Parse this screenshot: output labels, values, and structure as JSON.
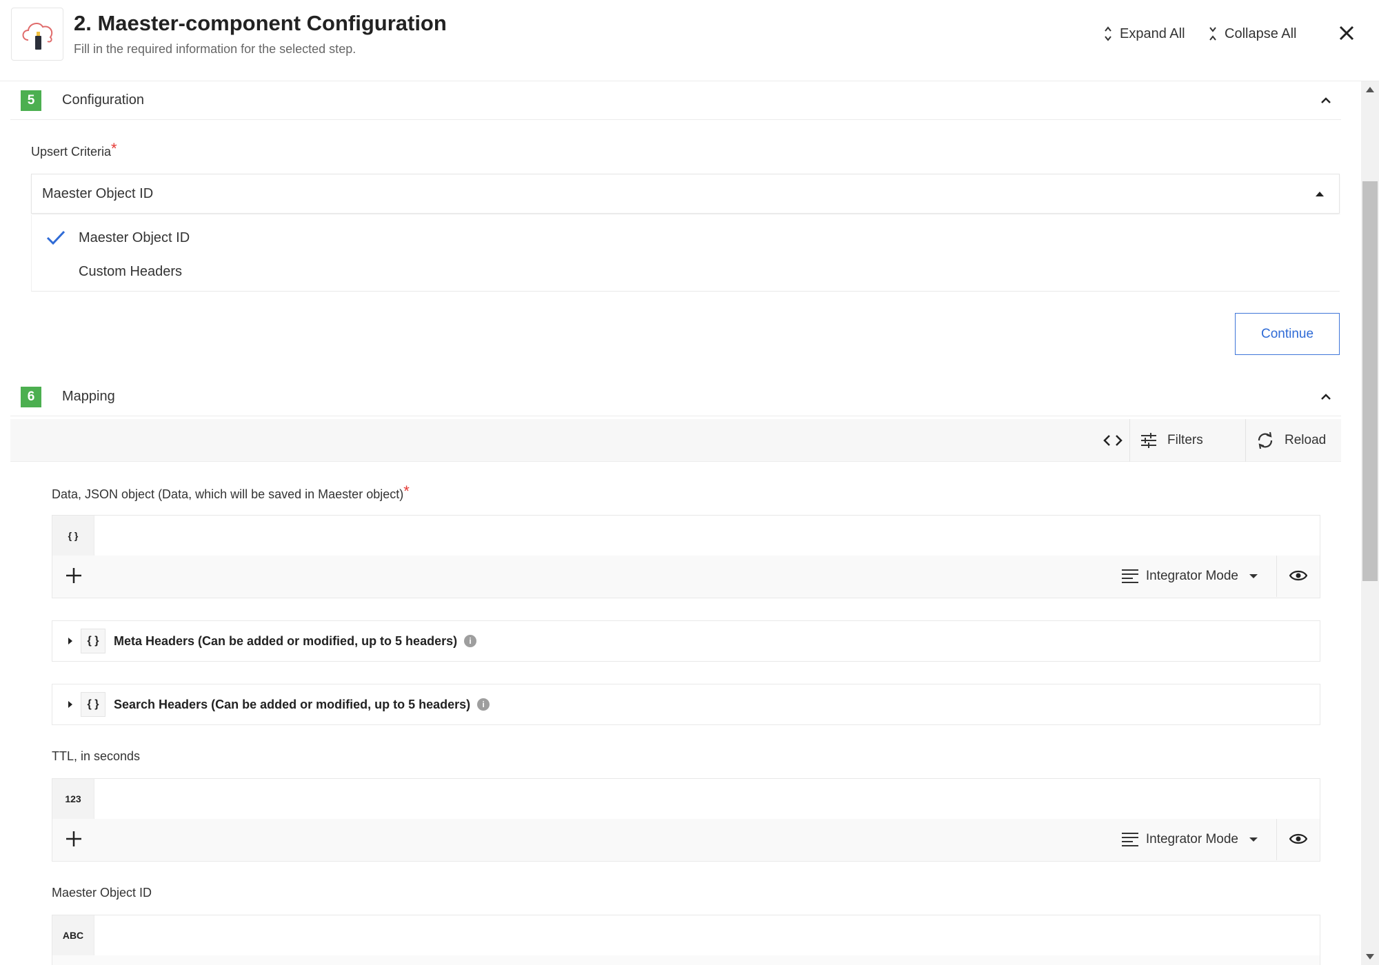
{
  "header": {
    "title": "2. Maester-component Configuration",
    "subtitle": "Fill in the required information for the selected step.",
    "expand_all": "Expand All",
    "collapse_all": "Collapse All"
  },
  "configuration": {
    "step": "5",
    "title": "Configuration",
    "upsert_label": "Upsert Criteria",
    "required_mark": "*",
    "selected": "Maester Object ID",
    "options": [
      "Maester Object ID",
      "Custom Headers"
    ],
    "continue_label": "Continue"
  },
  "mapping": {
    "step": "6",
    "title": "Mapping",
    "toolbar": {
      "filters": "Filters",
      "reload": "Reload"
    },
    "data_field": {
      "label": "Data, JSON object (Data, which will be saved in Maester object)",
      "required_mark": "*",
      "type": "{ }",
      "mode": "Integrator Mode"
    },
    "meta_headers": {
      "type": "{ }",
      "title": "Meta Headers (Can be added or modified, up to 5 headers)",
      "info": "i"
    },
    "search_headers": {
      "type": "{ }",
      "title": "Search Headers (Can be added or modified, up to 5 headers)",
      "info": "i"
    },
    "ttl_field": {
      "label": "TTL, in seconds",
      "type": "123",
      "mode": "Integrator Mode"
    },
    "object_id_field": {
      "label": "Maester Object ID",
      "type": "ABC"
    }
  },
  "colors": {
    "accent": "#2f6bd6",
    "step_badge": "#4caf50",
    "required": "#e53935"
  }
}
